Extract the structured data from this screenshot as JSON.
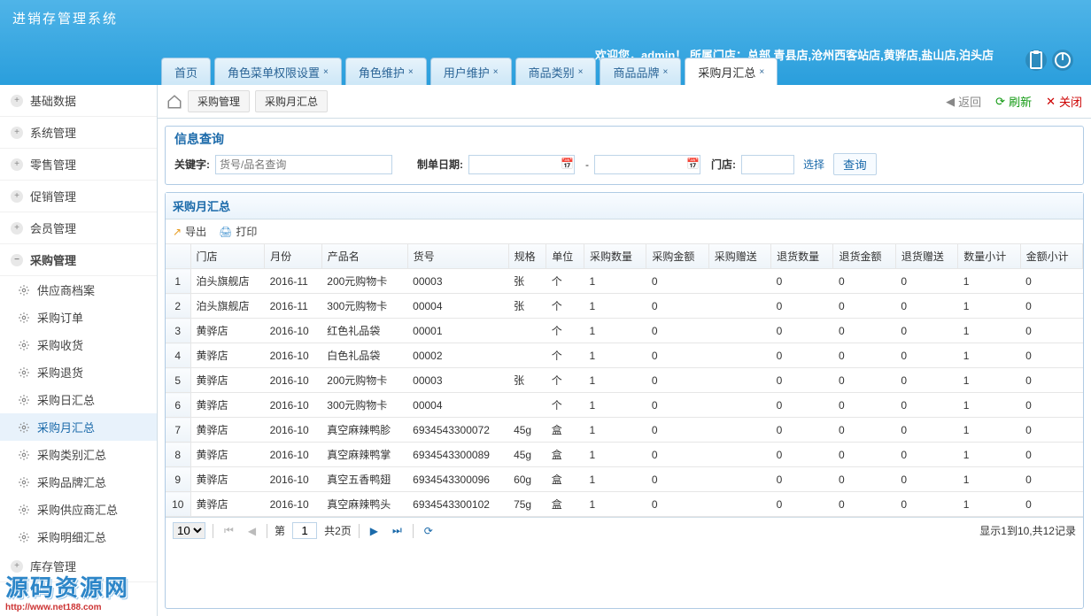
{
  "app_title": "进销存管理系统",
  "welcome": {
    "prefix": "欢迎您，",
    "user": "admin",
    "sep": "！",
    "store_label": "所属门店：",
    "stores": "总部,青县店,沧州西客站店,黄骅店,盐山店,泊头店"
  },
  "tabs": [
    "首页",
    "角色菜单权限设置",
    "角色维护",
    "用户维护",
    "商品类别",
    "商品品牌",
    "采购月汇总"
  ],
  "active_tab_index": 6,
  "crumb": {
    "group": "采购管理",
    "page": "采购月汇总"
  },
  "topactions": {
    "back": "返回",
    "refresh": "刷新",
    "close": "关闭"
  },
  "sidebar": {
    "groups": [
      "基础数据",
      "系统管理",
      "零售管理",
      "促销管理",
      "会员管理",
      "采购管理"
    ],
    "expanded_index": 5,
    "subs": [
      "供应商档案",
      "采购订单",
      "采购收货",
      "采购退货",
      "采购日汇总",
      "采购月汇总",
      "采购类别汇总",
      "采购品牌汇总",
      "采购供应商汇总",
      "采购明细汇总"
    ],
    "active_sub_index": 5,
    "trailing_group": "库存管理"
  },
  "filter": {
    "title": "信息查询",
    "kw_label": "关键字:",
    "kw_placeholder": "货号/品名查询",
    "date_label": "制单日期:",
    "date_sep": "-",
    "shop_label": "门店:",
    "select_link": "选择",
    "query_btn": "查询"
  },
  "panel_title": "采购月汇总",
  "toolbar": {
    "export": "导出",
    "print": "打印"
  },
  "columns": [
    "",
    "门店",
    "月份",
    "产品名",
    "货号",
    "规格",
    "单位",
    "采购数量",
    "采购金额",
    "采购赠送",
    "退货数量",
    "退货金额",
    "退货赠送",
    "数量小计",
    "金额小计"
  ],
  "rows": [
    [
      "1",
      "泊头旗舰店",
      "2016-11",
      "200元购物卡",
      "00003",
      "张",
      "个",
      "1",
      "0",
      "",
      "0",
      "0",
      "0",
      "1",
      "0"
    ],
    [
      "2",
      "泊头旗舰店",
      "2016-11",
      "300元购物卡",
      "00004",
      "张",
      "个",
      "1",
      "0",
      "",
      "0",
      "0",
      "0",
      "1",
      "0"
    ],
    [
      "3",
      "黄骅店",
      "2016-10",
      "红色礼品袋",
      "00001",
      "",
      "个",
      "1",
      "0",
      "",
      "0",
      "0",
      "0",
      "1",
      "0"
    ],
    [
      "4",
      "黄骅店",
      "2016-10",
      "白色礼品袋",
      "00002",
      "",
      "个",
      "1",
      "0",
      "",
      "0",
      "0",
      "0",
      "1",
      "0"
    ],
    [
      "5",
      "黄骅店",
      "2016-10",
      "200元购物卡",
      "00003",
      "张",
      "个",
      "1",
      "0",
      "",
      "0",
      "0",
      "0",
      "1",
      "0"
    ],
    [
      "6",
      "黄骅店",
      "2016-10",
      "300元购物卡",
      "00004",
      "",
      "个",
      "1",
      "0",
      "",
      "0",
      "0",
      "0",
      "1",
      "0"
    ],
    [
      "7",
      "黄骅店",
      "2016-10",
      "真空麻辣鸭胗",
      "6934543300072",
      "45g",
      "盒",
      "1",
      "0",
      "",
      "0",
      "0",
      "0",
      "1",
      "0"
    ],
    [
      "8",
      "黄骅店",
      "2016-10",
      "真空麻辣鸭掌",
      "6934543300089",
      "45g",
      "盒",
      "1",
      "0",
      "",
      "0",
      "0",
      "0",
      "1",
      "0"
    ],
    [
      "9",
      "黄骅店",
      "2016-10",
      "真空五香鸭翅",
      "6934543300096",
      "60g",
      "盒",
      "1",
      "0",
      "",
      "0",
      "0",
      "0",
      "1",
      "0"
    ],
    [
      "10",
      "黄骅店",
      "2016-10",
      "真空麻辣鸭头",
      "6934543300102",
      "75g",
      "盒",
      "1",
      "0",
      "",
      "0",
      "0",
      "0",
      "1",
      "0"
    ]
  ],
  "pager": {
    "page_size": "10",
    "page_label_prefix": "第",
    "page_label_suffix": "共2页",
    "current_page": "1",
    "info": "显示1到10,共12记录"
  },
  "watermark": {
    "text": "源码资源网",
    "url": "http://www.net188.com"
  }
}
